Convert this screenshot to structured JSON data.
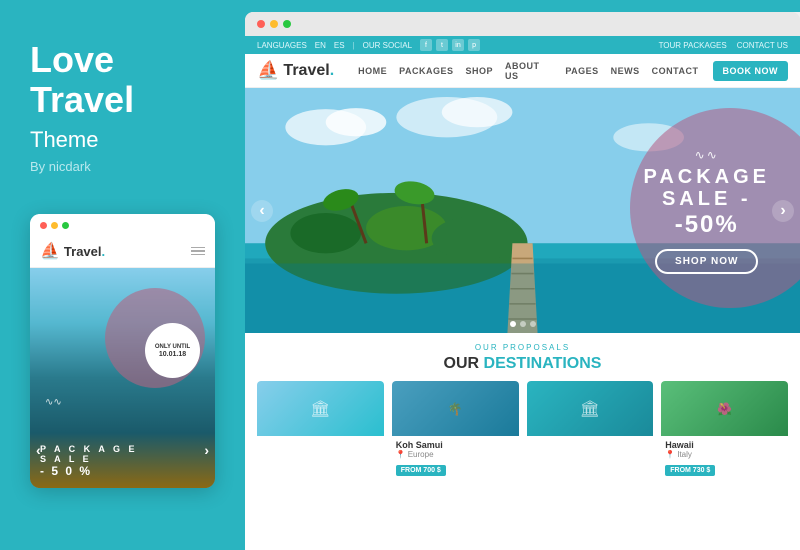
{
  "left": {
    "title_line1": "Love",
    "title_line2": "Travel",
    "subtitle": "Theme",
    "author": "By nicdark"
  },
  "mobile": {
    "dots": [
      "red",
      "yellow",
      "green"
    ],
    "logo_text": "Travel",
    "logo_dot": ".",
    "only_until": "ONLY UNTIL",
    "only_until_date": "10.01.18",
    "wave": "∿∿",
    "sale_line1": "P A C K A G E",
    "sale_line2": "S A L E",
    "sale_line3": "- 5 0 %"
  },
  "browser": {
    "dots": [
      "red",
      "yellow",
      "green"
    ],
    "utility_bar": {
      "languages": "LANGUAGES",
      "en": "EN",
      "es": "ES",
      "our_social": "OUR SOCIAL",
      "tour_packages": "TOUR PACKAGES",
      "contact_us": "CONTACT US"
    },
    "nav": {
      "logo_text": "Travel",
      "logo_dot": ".",
      "items": [
        "HOME",
        "PACKAGES",
        "SHOP",
        "ABOUT US",
        "PAGES",
        "NEWS",
        "CONTACT"
      ],
      "book_now": "BOOK NOW"
    },
    "hero": {
      "wave": "∿∿",
      "package": "PACKAGE",
      "sale": "SALE -",
      "off": "-50%",
      "shop_now": "SHOP NOW"
    },
    "destinations": {
      "eyebrow": "OUR PROPOSALS",
      "title_plain": "OUR ",
      "title_accent": "DESTINATIONS",
      "cards": [
        {
          "name": "",
          "location": "",
          "price": "",
          "bg": "#87ceeb"
        },
        {
          "name": "Koh Samui",
          "location": "Europe",
          "price": "FROM 700 $",
          "bg": "#4a9fbf"
        },
        {
          "name": "",
          "location": "",
          "price": "",
          "bg": "#2ab4c0"
        },
        {
          "name": "Hawaii",
          "location": "Italy",
          "price": "FROM 730 $",
          "bg": "#5abf7a"
        }
      ]
    }
  }
}
